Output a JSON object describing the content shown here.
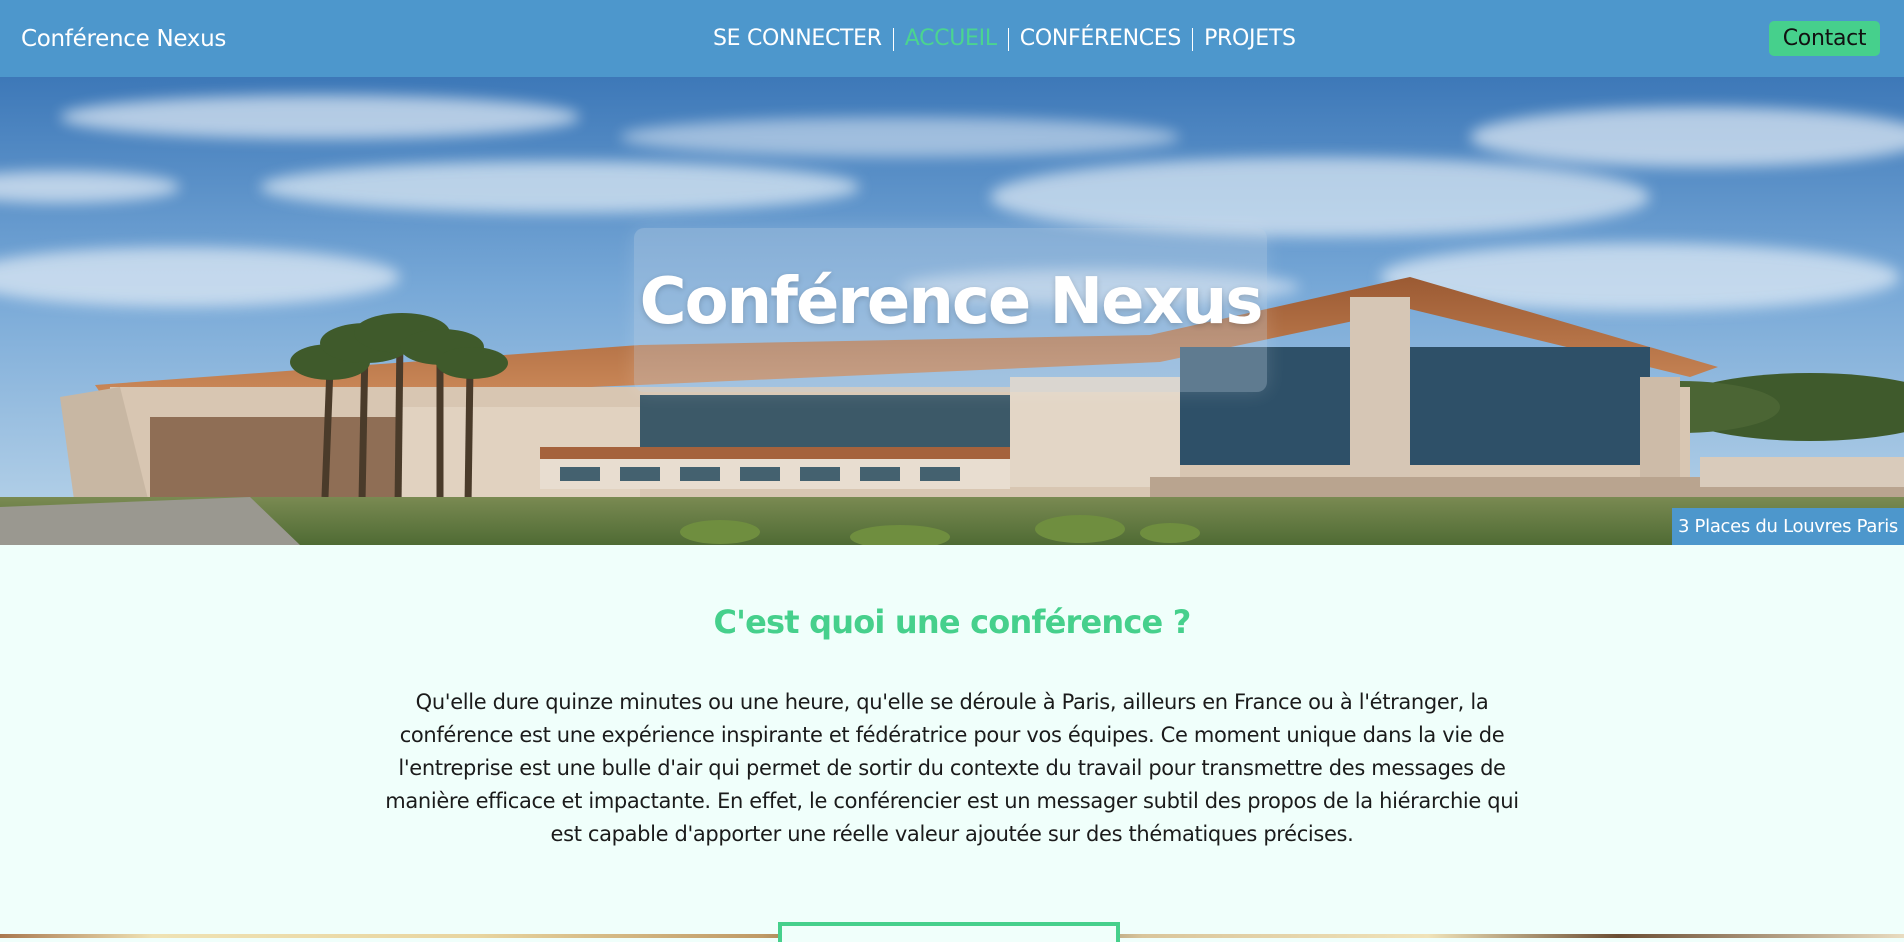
{
  "header": {
    "brand": "Conférence Nexus",
    "nav": [
      {
        "label": "SE CONNECTER",
        "active": false
      },
      {
        "label": "ACCUEIL",
        "active": true
      },
      {
        "label": "CONFÉRENCES",
        "active": false
      },
      {
        "label": "PROJETS",
        "active": false
      }
    ],
    "contact_label": "Contact"
  },
  "hero": {
    "title": "Conférence Nexus",
    "address": "3 Places du Louvres Paris"
  },
  "content": {
    "heading": "C'est quoi une conférence ?",
    "paragraph": "Qu'elle dure quinze minutes ou une heure, qu'elle se déroule à Paris, ailleurs en France ou à l'étranger, la conférence est une expérience inspirante et fédératrice pour vos équipes. Ce moment unique dans la vie de l'entreprise est une bulle d'air qui permet de sortir du contexte du travail pour transmettre des messages de manière efficace et impactante. En effet, le conférencier est un messager subtil des propos de la hiérarchie qui est capable d'apporter une réelle valeur ajoutée sur des thématiques précises."
  },
  "colors": {
    "nav_bg": "#4d97cc",
    "accent": "#46d08c",
    "page_bg": "#f0fffb"
  }
}
